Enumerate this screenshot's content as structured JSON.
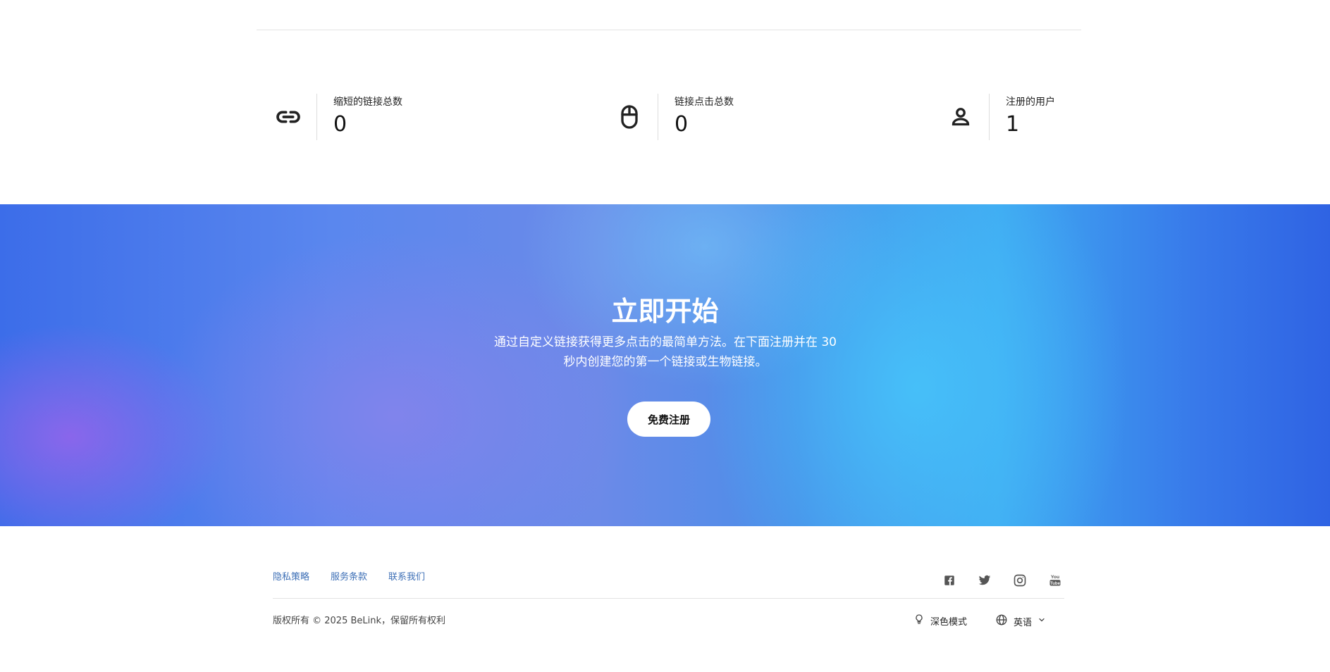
{
  "stats": [
    {
      "icon": "link-icon",
      "label": "缩短的链接总数",
      "value": "0"
    },
    {
      "icon": "mouse-icon",
      "label": "链接点击总数",
      "value": "0"
    },
    {
      "icon": "user-icon",
      "label": "注册的用户",
      "value": "1"
    }
  ],
  "hero": {
    "title": "立即开始",
    "subtitle_line1": "通过自定义链接获得更多点击的最简单方法。在下面注册并在 30",
    "subtitle_line2": "秒内创建您的第一个链接或生物链接。",
    "cta_label": "免费注册"
  },
  "footer": {
    "links": [
      "隐私策略",
      "服务条款",
      "联系我们"
    ],
    "social_icons": [
      "facebook-icon",
      "twitter-icon",
      "instagram-icon",
      "youtube-icon"
    ],
    "copyright": "版权所有 © 2025 BeLink，保留所有权利",
    "dark_mode_label": "深色模式",
    "language_label": "英语"
  },
  "colors": {
    "link": "#3d6fb6",
    "hero_blue": "#3879ea",
    "hero_purple": "#9664eb",
    "hero_cyan": "#46c3fa"
  }
}
